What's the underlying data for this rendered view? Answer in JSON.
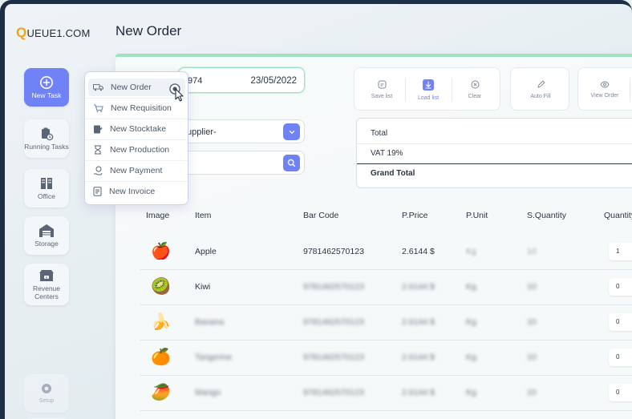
{
  "app": {
    "logo_letter": "Q",
    "logo_rest": "UEUE1.COM",
    "page_title": "New Order"
  },
  "sidebar": {
    "items": [
      {
        "label": "New Task",
        "icon": "plus-circle-icon",
        "active": true
      },
      {
        "label": "Running Tasks",
        "icon": "clipboard-clock-icon"
      },
      {
        "label": "Office",
        "icon": "office-building-icon"
      },
      {
        "label": "Storage",
        "icon": "warehouse-icon"
      },
      {
        "label": "Revenue Centers",
        "icon": "revenue-shop-icon"
      },
      {
        "label": "Setup",
        "icon": "gear-icon"
      }
    ]
  },
  "menu": {
    "items": [
      {
        "label": "New Order",
        "icon": "truck-icon"
      },
      {
        "label": "New Requisition",
        "icon": "cart-icon"
      },
      {
        "label": "New Stocktake",
        "icon": "clipboard-edit-icon"
      },
      {
        "label": "New Production",
        "icon": "production-icon"
      },
      {
        "label": "New Payment",
        "icon": "payment-hand-icon"
      },
      {
        "label": "New Invoice",
        "icon": "invoice-icon"
      }
    ]
  },
  "form": {
    "order_number": "974",
    "date": "23/05/2022",
    "supplier": "upplier-"
  },
  "toolbar": {
    "save_list": "Save list",
    "load_list": "Load list",
    "clear": "Clear",
    "auto_fill": "Auto Fill",
    "view_order": "View Order"
  },
  "totals": {
    "total": "Total",
    "vat": "VAT 19%",
    "grand_total": "Grand Total"
  },
  "table": {
    "headers": {
      "image": "Image",
      "item": "Item",
      "barcode": "Bar Code",
      "price": "P.Price",
      "unit": "P.Unit",
      "squantity": "S.Quantity",
      "quantity": "Quantity"
    },
    "rows": [
      {
        "emoji": "🍎",
        "item": "Apple",
        "barcode": "9781462570123",
        "price": "2.6144 $",
        "unit": "Kg",
        "squantity": "10",
        "quantity": "1"
      },
      {
        "emoji": "🥝",
        "item": "Kiwi",
        "barcode": "9781462570123",
        "price": "2.6144 $",
        "unit": "Kg",
        "squantity": "10",
        "quantity": "0"
      },
      {
        "emoji": "🍌",
        "item": "Banana",
        "barcode": "9781462570123",
        "price": "2.6144 $",
        "unit": "Kg",
        "squantity": "10",
        "quantity": "0"
      },
      {
        "emoji": "🍊",
        "item": "Tangerine",
        "barcode": "9781462570123",
        "price": "2.6144 $",
        "unit": "Kg",
        "squantity": "10",
        "quantity": "0"
      },
      {
        "emoji": "🥭",
        "item": "Mango",
        "barcode": "9781462570123",
        "price": "2.6144 $",
        "unit": "Kg",
        "squantity": "10",
        "quantity": "0"
      }
    ]
  },
  "colors": {
    "accent": "#6f82f6",
    "success_line": "#9de3c1",
    "frame": "#1d2f47",
    "logo": "#f0a11a"
  }
}
